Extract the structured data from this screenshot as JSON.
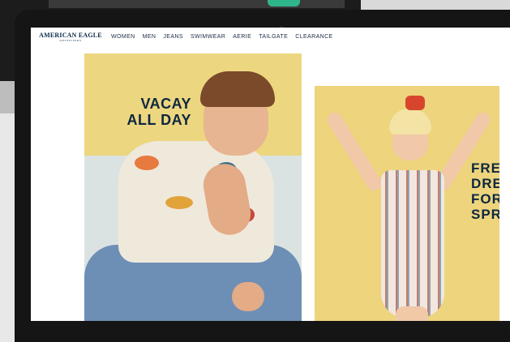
{
  "brand": {
    "name": "AMERICAN EAGLE",
    "subtitle": "OUTFITTERS"
  },
  "nav": {
    "items": [
      "WOMEN",
      "MEN",
      "JEANS",
      "SWIMWEAR",
      "AERIE",
      "TAILGATE",
      "CLEARANCE"
    ]
  },
  "hero_left": {
    "line1": "VACAY",
    "line2": "ALL DAY"
  },
  "hero_right": {
    "line1": "FRE",
    "line2": "DRE",
    "line3": "FOR",
    "line4": "SPR"
  },
  "colors": {
    "brand_navy": "#0d2740",
    "hero_yellow": "#ecd67f"
  }
}
